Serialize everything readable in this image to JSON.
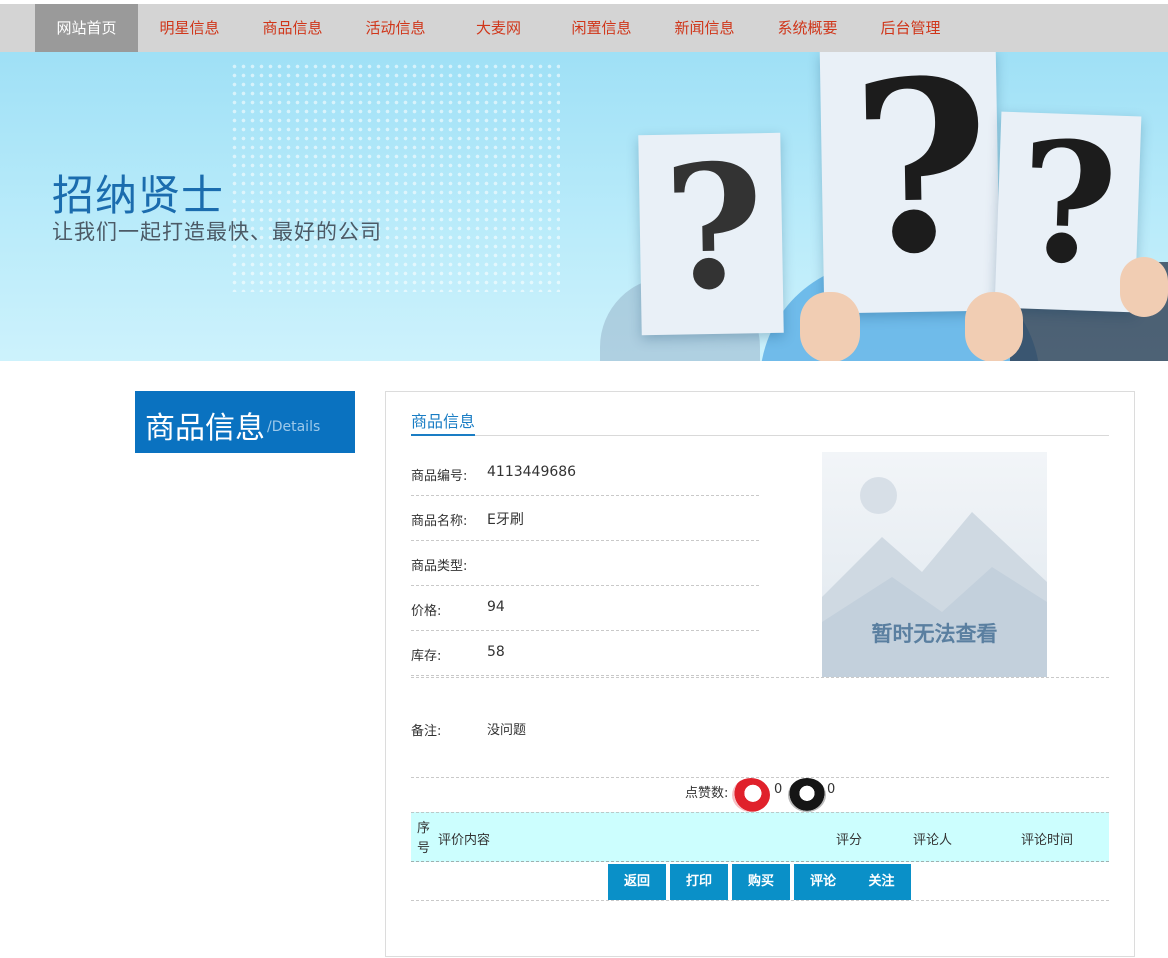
{
  "nav": {
    "items": [
      {
        "label": "网站首页",
        "active": true
      },
      {
        "label": "明星信息"
      },
      {
        "label": "商品信息"
      },
      {
        "label": "活动信息"
      },
      {
        "label": "大麦网"
      },
      {
        "label": "闲置信息"
      },
      {
        "label": "新闻信息"
      },
      {
        "label": "系统概要"
      },
      {
        "label": "后台管理"
      }
    ]
  },
  "banner": {
    "title": "招纳贤士",
    "subtitle": "让我们一起打造最快、最好的公司",
    "question_mark": "?"
  },
  "side": {
    "title": "商品信息",
    "subtitle": "/Details"
  },
  "panel": {
    "heading": "商品信息",
    "fields": [
      {
        "label": "商品编号:",
        "value": "4113449686"
      },
      {
        "label": "商品名称:",
        "value": "E牙刷"
      },
      {
        "label": "商品类型:",
        "value": ""
      },
      {
        "label": "价格:",
        "value": "94"
      },
      {
        "label": "库存:",
        "value": "58"
      }
    ],
    "image_placeholder": "暂时无法查看",
    "note": {
      "label": "备注:",
      "value": "没问题"
    },
    "likes": {
      "label": "点赞数:",
      "up_count": "0",
      "down_count": "0"
    },
    "table_headers": {
      "index": "序号",
      "content": "评价内容",
      "score": "评分",
      "commenter": "评论人",
      "time": "评论时间"
    },
    "buttons": {
      "back": "返回",
      "print": "打印",
      "buy": "购买",
      "comment": "评论",
      "follow": "关注"
    }
  },
  "colors": {
    "accent": "#0a72c0",
    "nav_text": "#d0361a",
    "button": "#0a90c8",
    "table_head": "#ccfefe"
  }
}
